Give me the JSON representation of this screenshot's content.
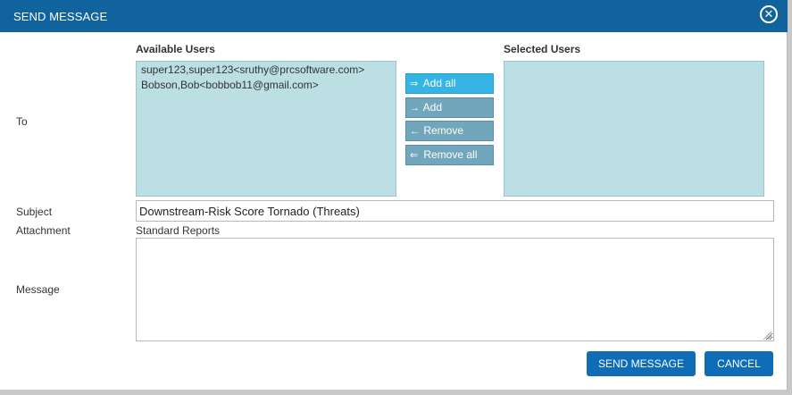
{
  "dialog": {
    "title": "SEND MESSAGE",
    "close_icon": "close-icon"
  },
  "form": {
    "to_label": "To",
    "subject_label": "Subject",
    "attachment_label": "Attachment",
    "message_label": "Message"
  },
  "available_users": {
    "header": "Available Users",
    "items": [
      "super123,super123<sruthy@prcsoftware.com>",
      "Bobson,Bob<bobbob11@gmail.com>"
    ]
  },
  "selected_users": {
    "header": "Selected Users",
    "items": []
  },
  "transfer_buttons": {
    "add_all": {
      "icon": "⇒",
      "label": "Add all"
    },
    "add": {
      "icon": "→",
      "label": "Add"
    },
    "remove": {
      "icon": "←",
      "label": "Remove"
    },
    "remove_all": {
      "icon": "⇐",
      "label": "Remove all"
    }
  },
  "subject": {
    "value": "Downstream-Risk Score Tornado (Threats)"
  },
  "attachment": {
    "value": "Standard Reports"
  },
  "message": {
    "value": ""
  },
  "actions": {
    "send_label": "SEND MESSAGE",
    "cancel_label": "CANCEL"
  },
  "colors": {
    "titlebar": "#11639d",
    "listbox": "#bcdfe3",
    "transfer_button": "#71a6bd",
    "transfer_button_active": "#36b5e5",
    "primary_button": "#0f6cb6"
  }
}
